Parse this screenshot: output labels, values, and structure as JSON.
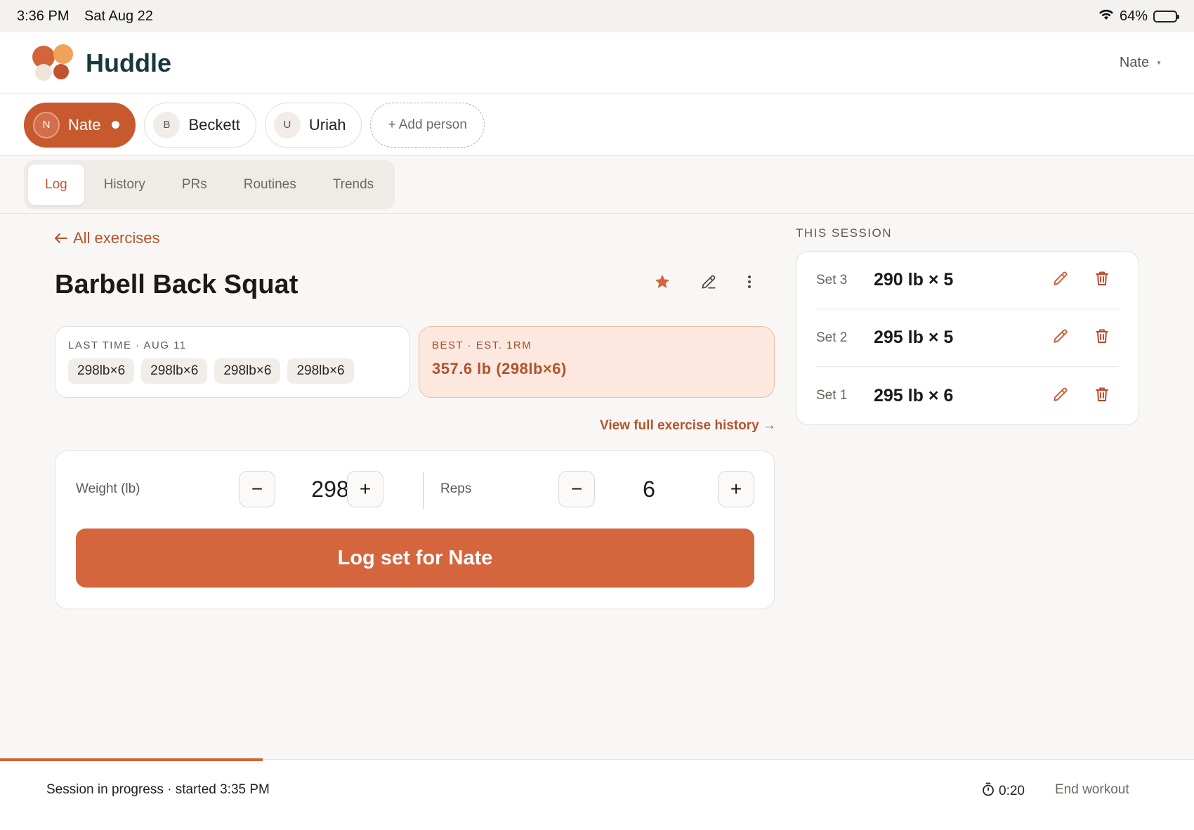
{
  "status_bar": {
    "time": "3:36 PM",
    "date": "Sat Aug 22",
    "wifi_icon": "wifi-icon",
    "battery_percent": "64%",
    "battery_level": 0.64
  },
  "header": {
    "app_name": "Huddle",
    "user_menu": "Nate"
  },
  "people": [
    {
      "initial": "N",
      "name": "Nate",
      "active": true
    },
    {
      "initial": "B",
      "name": "Beckett",
      "active": false
    },
    {
      "initial": "U",
      "name": "Uriah",
      "active": false
    }
  ],
  "add_person_label": "+ Add person",
  "tabs": [
    {
      "label": "Log",
      "active": true
    },
    {
      "label": "History",
      "active": false
    },
    {
      "label": "PRs",
      "active": false
    },
    {
      "label": "Routines",
      "active": false
    },
    {
      "label": "Trends",
      "active": false
    }
  ],
  "exercise": {
    "back_label": "All exercises",
    "title": "Barbell Back Squat",
    "favorited": true,
    "last_time": {
      "label": "LAST TIME · AUG 11",
      "sets": [
        "298lb×6",
        "298lb×6",
        "298lb×6",
        "298lb×6"
      ]
    },
    "best": {
      "label": "BEST · EST. 1RM",
      "value": "357.6 lb (298lb×6)"
    },
    "history_link": "View full exercise history →"
  },
  "logger": {
    "weight_label": "Weight (lb)",
    "weight_value": "298",
    "reps_label": "Reps",
    "reps_value": "6",
    "minus": "−",
    "plus": "+",
    "log_button": "Log set for Nate"
  },
  "session": {
    "label": "THIS SESSION",
    "sets": [
      {
        "name": "Set 3",
        "value": "290 lb × 5"
      },
      {
        "name": "Set 2",
        "value": "295 lb × 5"
      },
      {
        "name": "Set 1",
        "value": "295 lb × 6"
      }
    ]
  },
  "bottom_bar": {
    "status": "Session in progress · started 3:35 PM",
    "timer": "0:20",
    "end_label": "End workout",
    "progress_fraction": 0.22
  },
  "colors": {
    "accent": "#d4653c",
    "accent_dark": "#c7592f",
    "brand_text": "#17383d",
    "best_bg": "#fce8df"
  }
}
